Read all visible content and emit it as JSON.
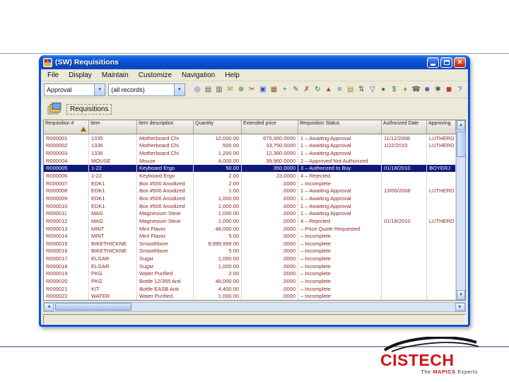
{
  "window": {
    "title": "(SW) Requisitions",
    "controls": {
      "close_glyph": "×"
    }
  },
  "menu": {
    "items": [
      "File",
      "Display",
      "Maintain",
      "Customize",
      "Navigation",
      "Help"
    ]
  },
  "toolbar": {
    "view_value": "Approval",
    "records_value": "(all records)",
    "combo_arrow": "▼",
    "icons": [
      {
        "name": "find-icon",
        "glyph": "◎",
        "color": "#3a57c4"
      },
      {
        "name": "print-icon",
        "glyph": "▤",
        "color": "#555555"
      },
      {
        "name": "print-preview-icon",
        "glyph": "▥",
        "color": "#555555"
      },
      {
        "name": "mail-icon",
        "glyph": "✉",
        "color": "#b08820"
      },
      {
        "name": "attach-icon",
        "glyph": "⊕",
        "color": "#2e7d32"
      },
      {
        "name": "cut-icon",
        "glyph": "✂",
        "color": "#555555"
      },
      {
        "name": "copy-icon",
        "glyph": "▣",
        "color": "#3a57c4"
      },
      {
        "name": "paste-icon",
        "glyph": "▦",
        "color": "#8a5a2a"
      },
      {
        "name": "new-record-icon",
        "glyph": "+",
        "color": "#2e7d32"
      },
      {
        "name": "edit-icon",
        "glyph": "✎",
        "color": "#555555"
      },
      {
        "name": "delete-icon",
        "glyph": "✗",
        "color": "#c0392b"
      },
      {
        "name": "refresh-icon",
        "glyph": "↻",
        "color": "#2e7d32"
      },
      {
        "name": "chart-icon",
        "glyph": "▲",
        "color": "#c0392b"
      },
      {
        "name": "calculator-icon",
        "glyph": "≡",
        "color": "#3a57c4"
      },
      {
        "name": "notes-icon",
        "glyph": "▤",
        "color": "#b08820"
      },
      {
        "name": "sort-icon",
        "glyph": "⇅",
        "color": "#555555"
      },
      {
        "name": "filter-icon",
        "glyph": "▽",
        "color": "#3a57c4"
      },
      {
        "name": "globe-icon",
        "glyph": "●",
        "color": "#2e7d32"
      },
      {
        "name": "currency-icon",
        "glyph": "$",
        "color": "#2e7d32"
      },
      {
        "name": "lock-icon",
        "glyph": "♦",
        "color": "#b08820"
      },
      {
        "name": "phone-icon",
        "glyph": "☎",
        "color": "#555555"
      },
      {
        "name": "user-icon",
        "glyph": "☻",
        "color": "#3a57c4"
      },
      {
        "name": "settings-icon",
        "glyph": "✱",
        "color": "#555555"
      },
      {
        "name": "exit-icon",
        "glyph": "◼",
        "color": "#c0392b"
      },
      {
        "name": "help-icon",
        "glyph": "?",
        "color": "#3a57c4"
      }
    ]
  },
  "tab": {
    "label": "Requisitions"
  },
  "grid": {
    "columns": [
      "Requisition #",
      "Item",
      "Item description",
      "Quantity",
      "Extended price",
      "Requisition Status",
      "Authorized Date",
      "Approving"
    ],
    "selected_index": 4,
    "rows": [
      {
        "id": "R000001",
        "item": "1335",
        "desc": "Motherboard Chi",
        "qty": "10,000.00",
        "price": "675,000.0000",
        "status": "1 – Awaiting Approval",
        "date": "11/12/2008",
        "approver": "LUTHERD"
      },
      {
        "id": "R000002",
        "item": "1336",
        "desc": "Motherboard Chi",
        "qty": "500.00",
        "price": "33,750.0000",
        "status": "1 – Awaiting Approval",
        "date": "1/22/2010",
        "approver": "LUTHERD"
      },
      {
        "id": "R000003",
        "item": "1336",
        "desc": "Motherboard Chi",
        "qty": "1,200.00",
        "price": "12,360.0000",
        "status": "1 – Awaiting Approval",
        "date": "",
        "approver": ""
      },
      {
        "id": "R000004",
        "item": "MOUSE",
        "desc": "Mouse",
        "qty": "4,000.00",
        "price": "39,960.0000",
        "status": "2 – Approved Not Authorized",
        "date": "",
        "approver": ""
      },
      {
        "id": "R000005",
        "item": "1-22",
        "desc": "Keyboard Ergo",
        "qty": "50.00",
        "price": "350.0000",
        "status": "3 – Authorized to Buy",
        "date": "01/18/2010",
        "approver": "BOYERJ"
      },
      {
        "id": "R000006",
        "item": "1-22",
        "desc": "Keyboard Ergo",
        "qty": "2.00",
        "price": "23.0000",
        "status": "4 – Rejected",
        "date": "",
        "approver": ""
      },
      {
        "id": "R000007",
        "item": "EDK1",
        "desc": "Box #500 Anodized",
        "qty": "2.00",
        "price": ".0000",
        "status": "– Incomplete",
        "date": "",
        "approver": ""
      },
      {
        "id": "R000008",
        "item": "EDK1",
        "desc": "Box #500 Anodized",
        "qty": "1.00",
        "price": ".0000",
        "status": "1 – Awaiting Approval",
        "date": "13/06/2008",
        "approver": "LUTHERD"
      },
      {
        "id": "R000009",
        "item": "EDK1",
        "desc": "Box #500 Anodized",
        "qty": "1,000.00",
        "price": ".0000",
        "status": "1 – Awaiting Approval",
        "date": "",
        "approver": ""
      },
      {
        "id": "R000010",
        "item": "EDK1",
        "desc": "Box #500 Anodized",
        "qty": "1,000.00",
        "price": ".0000",
        "status": "1 – Awaiting Approval",
        "date": "",
        "approver": ""
      },
      {
        "id": "R000011",
        "item": "MAG",
        "desc": "Magnesium Stear",
        "qty": "1,000.00",
        "price": ".0000",
        "status": "1 – Awaiting Approval",
        "date": "",
        "approver": ""
      },
      {
        "id": "R000012",
        "item": "MAG",
        "desc": "Magnesium Stear",
        "qty": "1,000.00",
        "price": ".0000",
        "status": "4 – Rejected",
        "date": "01/18/2010",
        "approver": "LUTHERD"
      },
      {
        "id": "R000013",
        "item": "MINT",
        "desc": "Mint Flavor",
        "qty": "48,000.00",
        "price": ".0000",
        "status": "– Price Quote Requested",
        "date": "",
        "approver": ""
      },
      {
        "id": "R000014",
        "item": "MINT",
        "desc": "Mint Flavor",
        "qty": "5.00",
        "price": ".0000",
        "status": "– Incomplete",
        "date": "",
        "approver": ""
      },
      {
        "id": "R000015",
        "item": "BIKETHICKNE",
        "desc": "Smoothbore",
        "qty": "9,999,999.00",
        "price": ".0000",
        "status": "– Incomplete",
        "date": "",
        "approver": ""
      },
      {
        "id": "R000016",
        "item": "BIKETHICKNE",
        "desc": "Smoothbore",
        "qty": "5.00",
        "price": ".0000",
        "status": "– Incomplete",
        "date": "",
        "approver": ""
      },
      {
        "id": "R000017",
        "item": "ELGAR",
        "desc": "Sugar",
        "qty": "1,000.00",
        "price": ".0000",
        "status": "– Incomplete",
        "date": "",
        "approver": ""
      },
      {
        "id": "R000018",
        "item": "ELGAR",
        "desc": "Sugar",
        "qty": "1,000.00",
        "price": ".0000",
        "status": "– Incomplete",
        "date": "",
        "approver": ""
      },
      {
        "id": "R000019",
        "item": "PKG",
        "desc": "Water Purified",
        "qty": "2.00",
        "price": ".0000",
        "status": "– Incomplete",
        "date": "",
        "approver": ""
      },
      {
        "id": "R000020",
        "item": "PKG",
        "desc": "Bottle 12/355 Anti",
        "qty": "48,000.00",
        "price": ".0000",
        "status": "– Incomplete",
        "date": "",
        "approver": ""
      },
      {
        "id": "R000021",
        "item": "KIT",
        "desc": "Bottle EASB Anti",
        "qty": "4,400.00",
        "price": ".0000",
        "status": "– Incomplete",
        "date": "",
        "approver": ""
      },
      {
        "id": "R000022",
        "item": "WATER",
        "desc": "Water Purified",
        "qty": "1,000.00",
        "price": ".0000",
        "status": "– Incomplete",
        "date": "",
        "approver": ""
      }
    ]
  },
  "statusbar": {
    "text": ""
  },
  "logo": {
    "brand": "CISTECH",
    "tagline_pre": "The ",
    "tagline_em": "MAPICS",
    "tagline_post": " Experts"
  }
}
